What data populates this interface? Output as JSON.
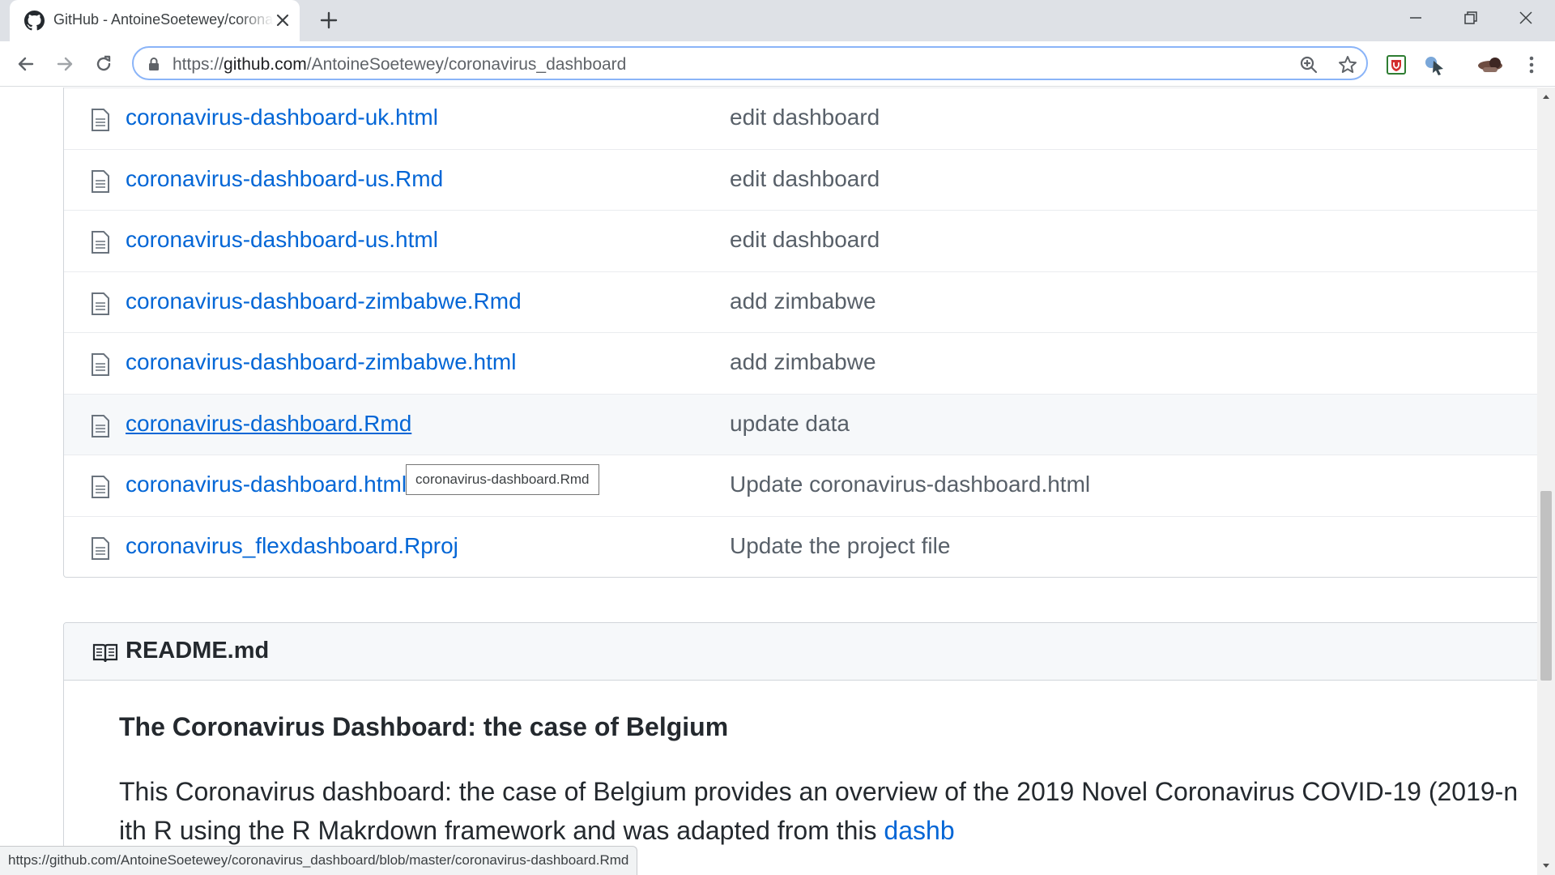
{
  "browser": {
    "tab_title": "GitHub - AntoineSoetewey/coronavirus_dashboard",
    "url_scheme": "https://",
    "url_host": "github.com",
    "url_path": "/AntoineSoetewey/coronavirus_dashboard",
    "status_url": "https://github.com/AntoineSoetewey/coronavirus_dashboard/blob/master/coronavirus-dashboard.Rmd"
  },
  "files": [
    {
      "name": "coronavirus-dashboard-uk.html",
      "message": "edit dashboard"
    },
    {
      "name": "coronavirus-dashboard-us.Rmd",
      "message": "edit dashboard"
    },
    {
      "name": "coronavirus-dashboard-us.html",
      "message": "edit dashboard"
    },
    {
      "name": "coronavirus-dashboard-zimbabwe.Rmd",
      "message": "add zimbabwe"
    },
    {
      "name": "coronavirus-dashboard-zimbabwe.html",
      "message": "add zimbabwe"
    },
    {
      "name": "coronavirus-dashboard.Rmd",
      "message": "update data"
    },
    {
      "name": "coronavirus-dashboard.html",
      "message": "Update coronavirus-dashboard.html"
    },
    {
      "name": "coronavirus_flexdashboard.Rproj",
      "message": "Update the project file"
    }
  ],
  "tooltip": "coronavirus-dashboard.Rmd",
  "readme": {
    "title": "README.md",
    "heading": "The Coronavirus Dashboard: the case of Belgium",
    "p1": "This Coronavirus dashboard: the case of Belgium provides an overview of the 2019 Novel Coronavirus COVID-19 (2019-n",
    "p2_text": "ith R using the R Makrdown framework and was adapted from this ",
    "p2_link": "dashb"
  },
  "colors": {
    "link": "#0366d6",
    "muted": "#586069",
    "border": "#d1d5da",
    "row_hover": "#f6f8fa",
    "focus_ring": "#8ab4f8"
  },
  "icons": {
    "favicon": "github-icon",
    "file": "file-icon",
    "readme": "book-icon",
    "lock": "lock-icon"
  }
}
